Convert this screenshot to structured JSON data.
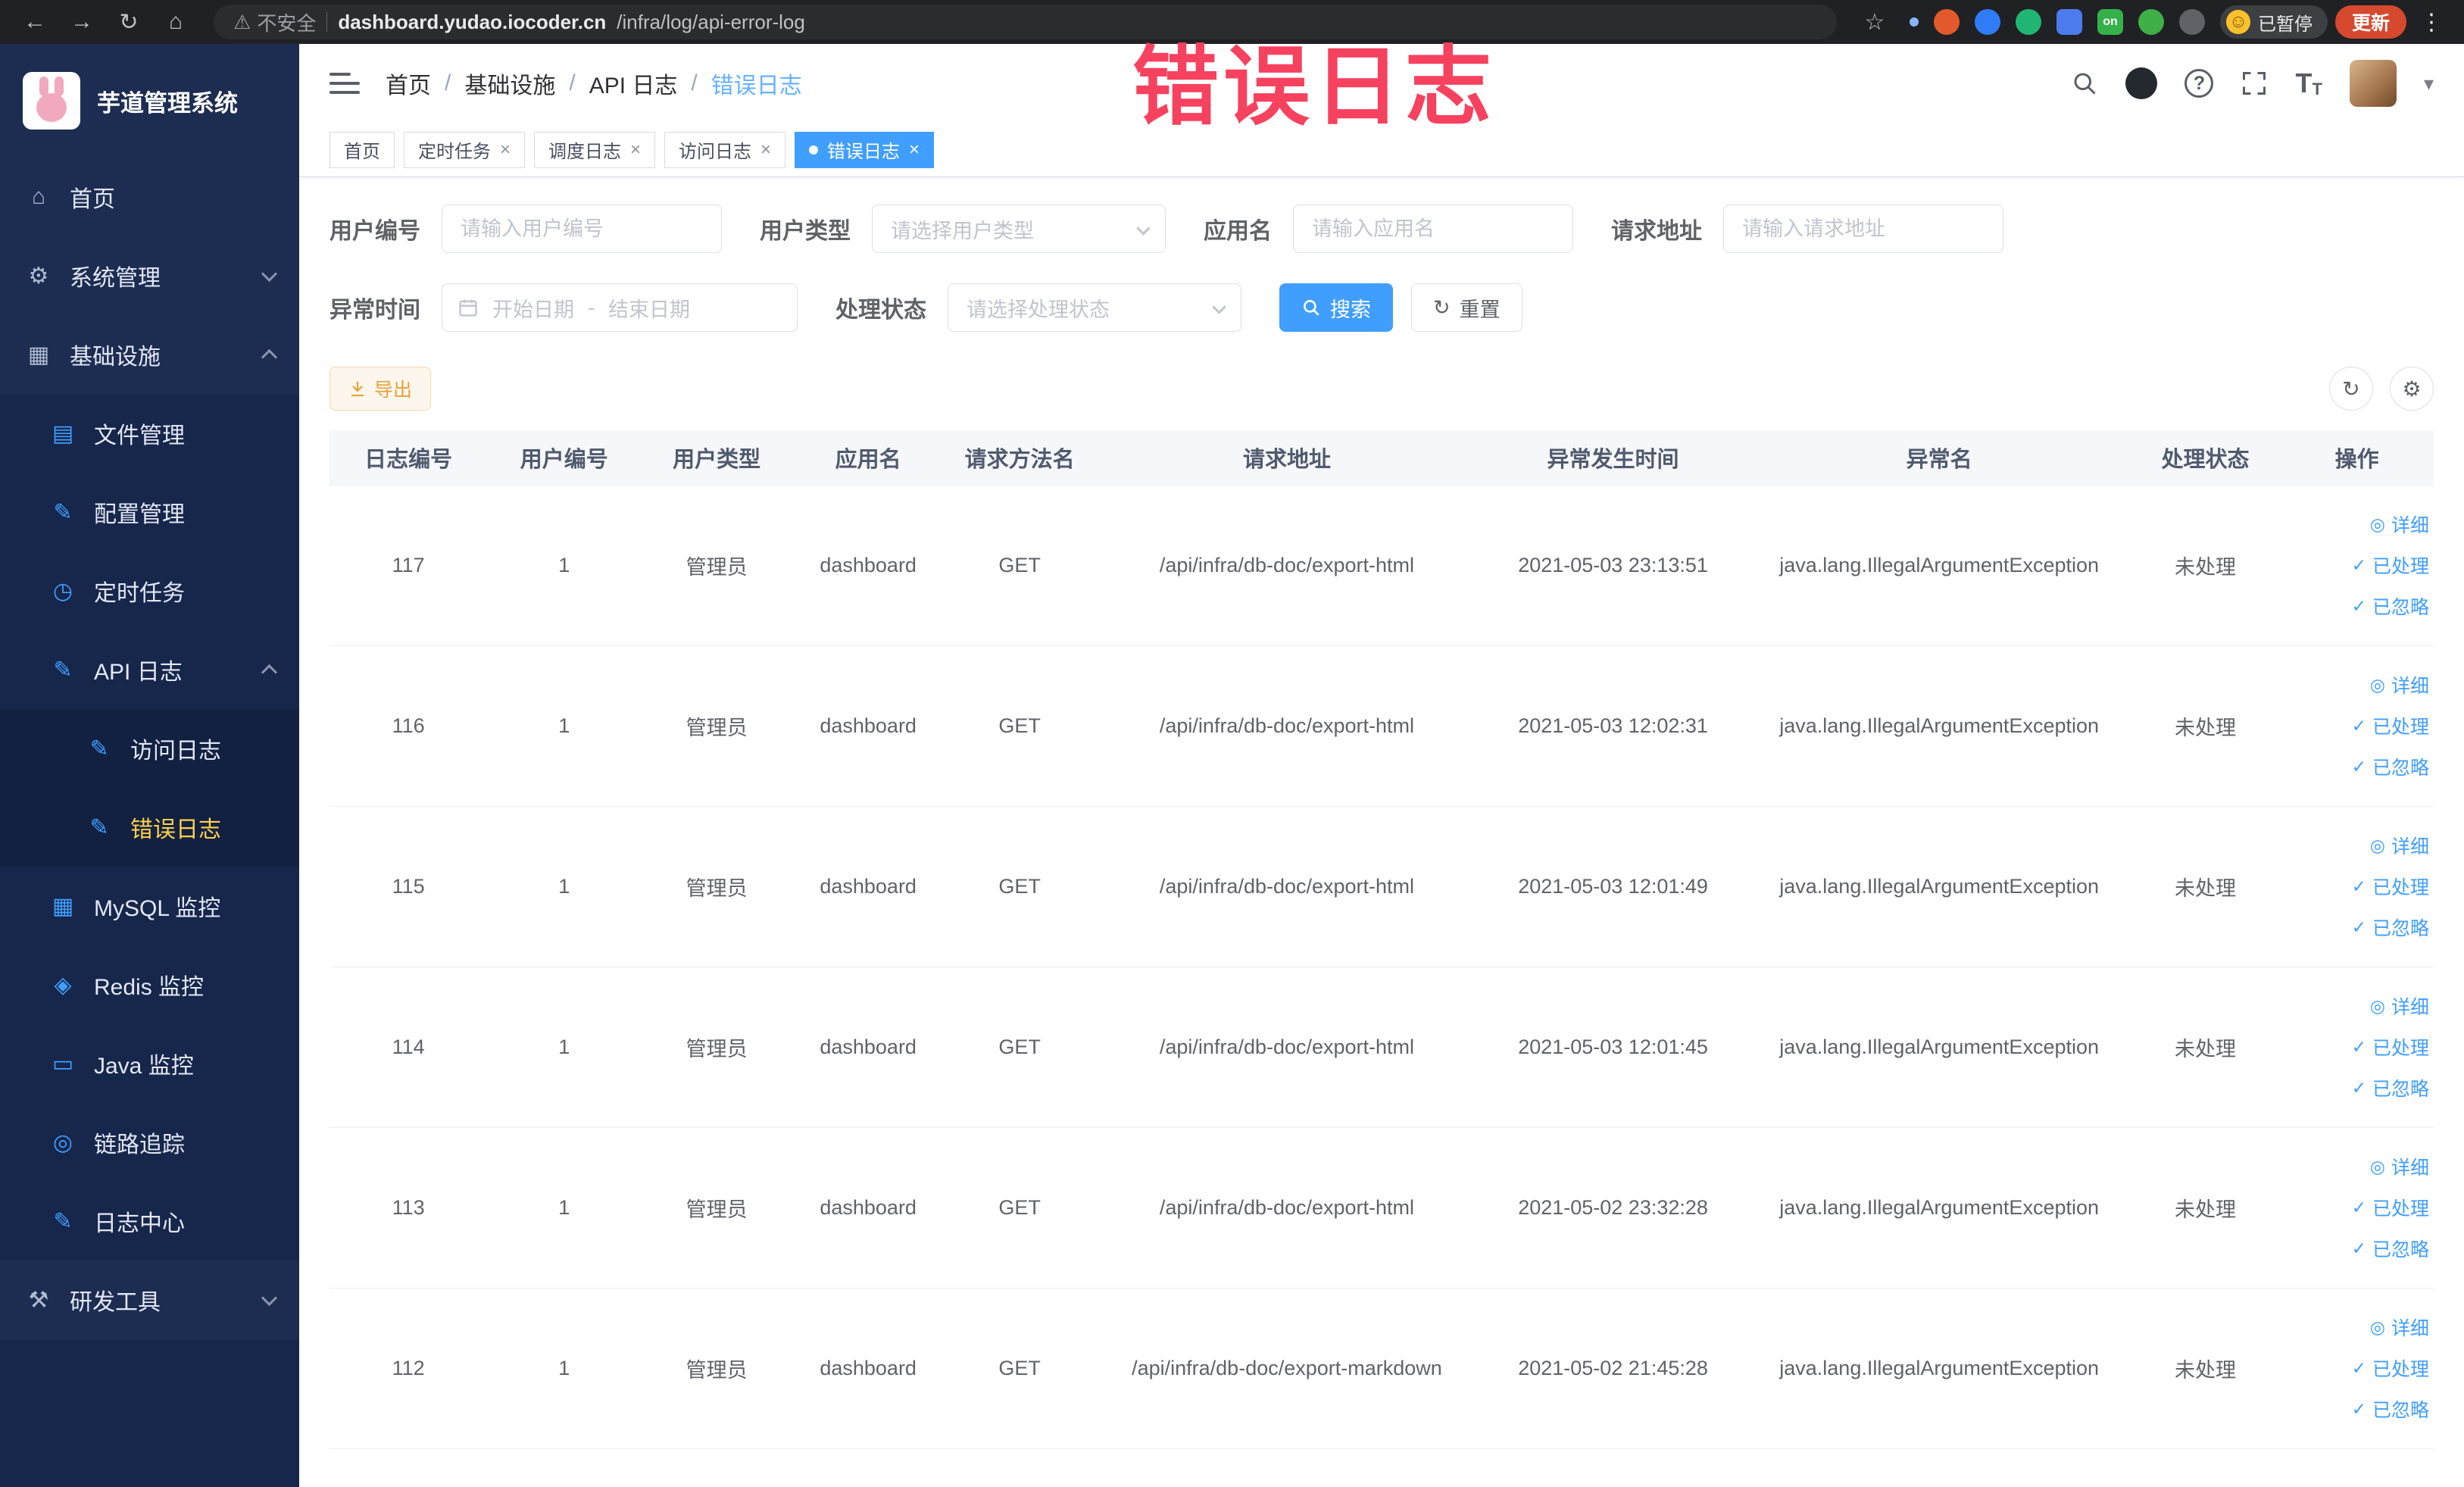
{
  "watermark": "错误日志",
  "colors": {
    "accent": "#409eff",
    "watermark_red": "#f6415f",
    "warning": "#e6a23c",
    "sidebar_active": "#ffd04b"
  },
  "icons": {
    "back": "←",
    "forward": "→",
    "reload": "↻",
    "home": "⌂",
    "warning": "⚠",
    "star": "☆",
    "kebab": "⋮",
    "caret": "▾",
    "close": "×",
    "slash": "/",
    "question": "?",
    "text_size_large": "T",
    "text_size_small": "T",
    "eye": "◎",
    "check": "✓",
    "refresh": "↻",
    "gear": "⚙",
    "smiley": "☺"
  },
  "browser": {
    "security_label": "不安全",
    "url_domain": "dashboard.yudao.iocoder.cn",
    "url_path": "/infra/log/api-error-log",
    "extension_on_badge": "on",
    "paused_badge": "已暂停",
    "update_button": "更新"
  },
  "sidebar": {
    "logo_title": "芋道管理系统",
    "items": [
      {
        "label": "首页",
        "glyph": "⌂"
      },
      {
        "label": "系统管理",
        "glyph": "⚙"
      },
      {
        "label": "基础设施",
        "glyph": "▦"
      },
      {
        "label": "文件管理",
        "glyph": "▤"
      },
      {
        "label": "配置管理",
        "glyph": "✎"
      },
      {
        "label": "定时任务",
        "glyph": "◷"
      },
      {
        "label": "API 日志",
        "glyph": "✎"
      },
      {
        "label": "访问日志",
        "glyph": "✎"
      },
      {
        "label": "错误日志",
        "glyph": "✎"
      },
      {
        "label": "MySQL 监控",
        "glyph": "▦"
      },
      {
        "label": "Redis 监控",
        "glyph": "◈"
      },
      {
        "label": "Java 监控",
        "glyph": "▭"
      },
      {
        "label": "链路追踪",
        "glyph": "◎"
      },
      {
        "label": "日志中心",
        "glyph": "✎"
      },
      {
        "label": "研发工具",
        "glyph": "⚒"
      }
    ]
  },
  "header": {
    "breadcrumb": [
      "首页",
      "基础设施",
      "API 日志",
      "错误日志"
    ]
  },
  "tabs": [
    {
      "label": "首页",
      "active": false,
      "closable": false
    },
    {
      "label": "定时任务",
      "active": false,
      "closable": true
    },
    {
      "label": "调度日志",
      "active": false,
      "closable": true
    },
    {
      "label": "访问日志",
      "active": false,
      "closable": true
    },
    {
      "label": "错误日志",
      "active": true,
      "closable": true
    }
  ],
  "filters": {
    "user_id": {
      "label": "用户编号",
      "placeholder": "请输入用户编号"
    },
    "user_type": {
      "label": "用户类型",
      "placeholder": "请选择用户类型"
    },
    "app_name": {
      "label": "应用名",
      "placeholder": "请输入应用名"
    },
    "request_url": {
      "label": "请求地址",
      "placeholder": "请输入请求地址"
    },
    "exception_time": {
      "label": "异常时间",
      "start_placeholder": "开始日期",
      "separator": "-",
      "end_placeholder": "结束日期"
    },
    "process_status": {
      "label": "处理状态",
      "placeholder": "请选择处理状态"
    },
    "search_button": "搜索",
    "reset_button": "重置"
  },
  "toolbar": {
    "export_button": "导出"
  },
  "table": {
    "columns": [
      "日志编号",
      "用户编号",
      "用户类型",
      "应用名",
      "请求方法名",
      "请求地址",
      "异常发生时间",
      "异常名",
      "处理状态",
      "操作"
    ],
    "row_actions": [
      "详细",
      "已处理",
      "已忽略"
    ],
    "rows": [
      {
        "id": "117",
        "user_id": "1",
        "user_type": "管理员",
        "app": "dashboard",
        "method": "GET",
        "url": "/api/infra/db-doc/export-html",
        "time": "2021-05-03 23:13:51",
        "exception": "java.lang.IllegalArgumentException",
        "status": "未处理"
      },
      {
        "id": "116",
        "user_id": "1",
        "user_type": "管理员",
        "app": "dashboard",
        "method": "GET",
        "url": "/api/infra/db-doc/export-html",
        "time": "2021-05-03 12:02:31",
        "exception": "java.lang.IllegalArgumentException",
        "status": "未处理"
      },
      {
        "id": "115",
        "user_id": "1",
        "user_type": "管理员",
        "app": "dashboard",
        "method": "GET",
        "url": "/api/infra/db-doc/export-html",
        "time": "2021-05-03 12:01:49",
        "exception": "java.lang.IllegalArgumentException",
        "status": "未处理"
      },
      {
        "id": "114",
        "user_id": "1",
        "user_type": "管理员",
        "app": "dashboard",
        "method": "GET",
        "url": "/api/infra/db-doc/export-html",
        "time": "2021-05-03 12:01:45",
        "exception": "java.lang.IllegalArgumentException",
        "status": "未处理"
      },
      {
        "id": "113",
        "user_id": "1",
        "user_type": "管理员",
        "app": "dashboard",
        "method": "GET",
        "url": "/api/infra/db-doc/export-html",
        "time": "2021-05-02 23:32:28",
        "exception": "java.lang.IllegalArgumentException",
        "status": "未处理"
      },
      {
        "id": "112",
        "user_id": "1",
        "user_type": "管理员",
        "app": "dashboard",
        "method": "GET",
        "url": "/api/infra/db-doc/export-markdown",
        "time": "2021-05-02 21:45:28",
        "exception": "java.lang.IllegalArgumentException",
        "status": "未处理"
      }
    ]
  }
}
